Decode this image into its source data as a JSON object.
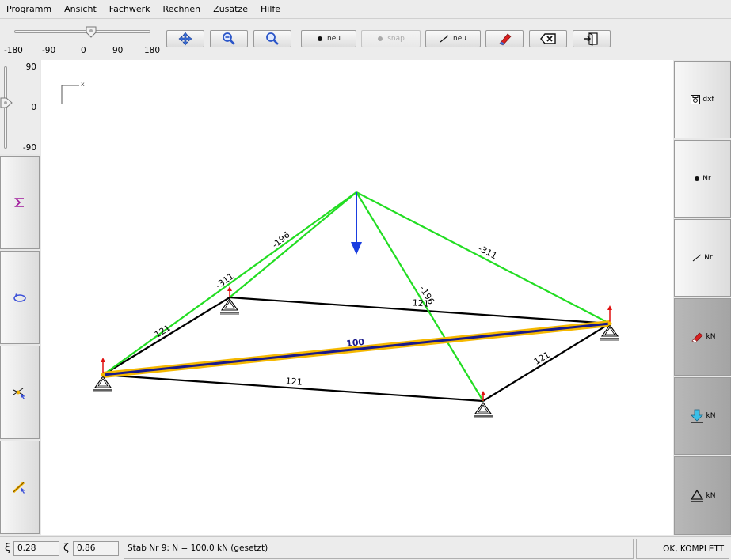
{
  "menu": [
    "Programm",
    "Ansicht",
    "Fachwerk",
    "Rechnen",
    "Zusätze",
    "Hilfe"
  ],
  "hslider": {
    "value": 0,
    "ticks": [
      "-180",
      "-90",
      "0",
      "90",
      "180"
    ]
  },
  "vslider": {
    "value": 0,
    "ticks": [
      "90",
      "0",
      "-90"
    ]
  },
  "toolbar": {
    "node_new_label": "neu",
    "node_snap_label": "snap",
    "bar_new_label": "neu"
  },
  "left_buttons": [
    "sigma-icon",
    "rotate-icon",
    "select-node-icon",
    "select-bar-icon"
  ],
  "right_panel": {
    "dxf_label": "dxf",
    "node_nr_label": "Nr",
    "bar_nr_label": "Nr",
    "force_kn_label": "kN",
    "load_kn_label": "kN",
    "support_kn_label": "kN"
  },
  "axis_label": "x",
  "truss_labels": {
    "bar_left_diag": "-196",
    "bar_left_up": "-311",
    "bar_right_up": "-311",
    "bar_center_diag": "-196",
    "bar_back": "121",
    "bar_left_back": "121",
    "bar_front": "121",
    "bar_right_front": "121",
    "bar_selected": "100"
  },
  "colors": {
    "compression": "#22dd22",
    "tension": "#000000",
    "selected_bar": "#1a1a8c",
    "selection_halo": "#f5b800",
    "load_arrow": "#1a3ee0",
    "reaction_arrow": "#e01010"
  },
  "status": {
    "xi_symbol": "ξ",
    "xi_value": "0.28",
    "zeta_symbol": "ζ",
    "zeta_value": "0.86",
    "message": "Stab Nr 9: N = 100.0 kN (gesetzt)",
    "state": "OK, KOMPLETT"
  }
}
